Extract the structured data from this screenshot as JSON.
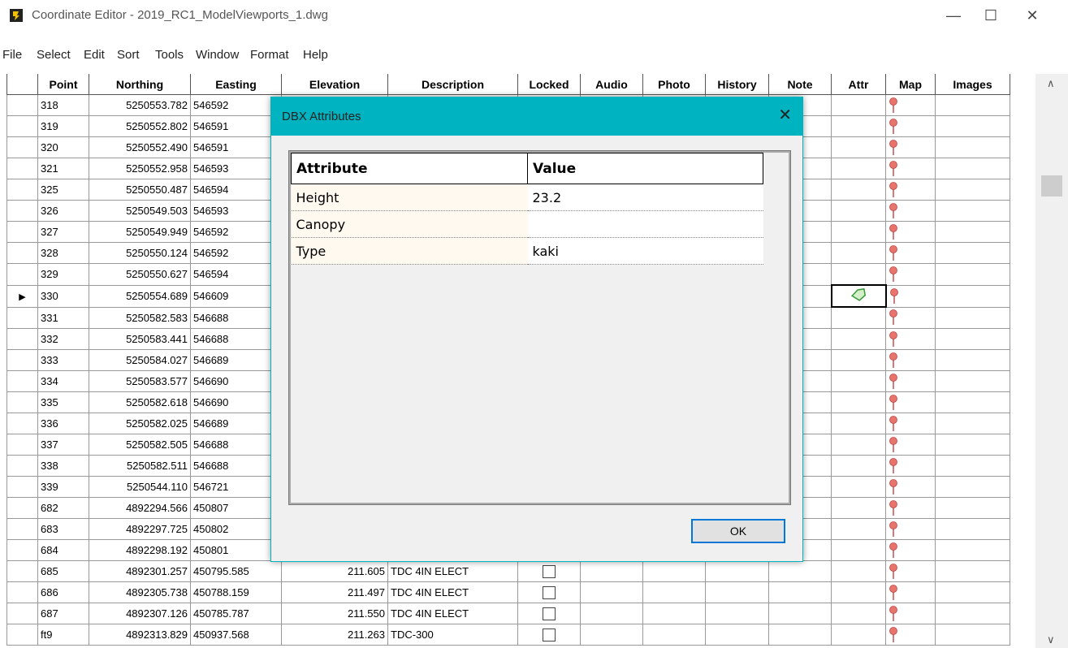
{
  "window": {
    "title": "Coordinate Editor - 2019_RC1_ModelViewports_1.dwg"
  },
  "menu": [
    "File",
    "Select",
    "Edit",
    "Sort",
    "Tools",
    "Window",
    "Format",
    "Help"
  ],
  "columns": [
    "Point",
    "Northing",
    "Easting",
    "Elevation",
    "Description",
    "Locked",
    "Audio",
    "Photo",
    "History",
    "Note",
    "Attr",
    "Map",
    "Images"
  ],
  "rows": [
    {
      "point": "318",
      "northing": "5250553.782",
      "easting": "546592",
      "elev": "",
      "desc": "",
      "locked": false
    },
    {
      "point": "319",
      "northing": "5250552.802",
      "easting": "546591",
      "elev": "",
      "desc": "",
      "locked": false
    },
    {
      "point": "320",
      "northing": "5250552.490",
      "easting": "546591",
      "elev": "",
      "desc": "",
      "locked": false
    },
    {
      "point": "321",
      "northing": "5250552.958",
      "easting": "546593",
      "elev": "",
      "desc": "",
      "locked": false
    },
    {
      "point": "325",
      "northing": "5250550.487",
      "easting": "546594",
      "elev": "",
      "desc": "",
      "locked": false
    },
    {
      "point": "326",
      "northing": "5250549.503",
      "easting": "546593",
      "elev": "",
      "desc": "",
      "locked": false
    },
    {
      "point": "327",
      "northing": "5250549.949",
      "easting": "546592",
      "elev": "",
      "desc": "",
      "locked": false
    },
    {
      "point": "328",
      "northing": "5250550.124",
      "easting": "546592",
      "elev": "",
      "desc": "",
      "locked": false
    },
    {
      "point": "329",
      "northing": "5250550.627",
      "easting": "546594",
      "elev": "",
      "desc": "",
      "locked": false
    },
    {
      "point": "330",
      "northing": "5250554.689",
      "easting": "546609",
      "elev": "",
      "desc": "",
      "locked": false,
      "selected": true,
      "attr": true
    },
    {
      "point": "331",
      "northing": "5250582.583",
      "easting": "546688",
      "elev": "",
      "desc": "",
      "locked": false
    },
    {
      "point": "332",
      "northing": "5250583.441",
      "easting": "546688",
      "elev": "",
      "desc": "",
      "locked": false
    },
    {
      "point": "333",
      "northing": "5250584.027",
      "easting": "546689",
      "elev": "",
      "desc": "",
      "locked": false
    },
    {
      "point": "334",
      "northing": "5250583.577",
      "easting": "546690",
      "elev": "",
      "desc": "",
      "locked": false
    },
    {
      "point": "335",
      "northing": "5250582.618",
      "easting": "546690",
      "elev": "",
      "desc": "",
      "locked": false
    },
    {
      "point": "336",
      "northing": "5250582.025",
      "easting": "546689",
      "elev": "",
      "desc": "",
      "locked": false
    },
    {
      "point": "337",
      "northing": "5250582.505",
      "easting": "546688",
      "elev": "",
      "desc": "",
      "locked": false
    },
    {
      "point": "338",
      "northing": "5250582.511",
      "easting": "546688",
      "elev": "",
      "desc": "",
      "locked": false
    },
    {
      "point": "339",
      "northing": "5250544.110",
      "easting": "546721",
      "elev": "",
      "desc": "",
      "locked": false
    },
    {
      "point": "682",
      "northing": "4892294.566",
      "easting": "450807",
      "elev": "",
      "desc": "",
      "locked": false
    },
    {
      "point": "683",
      "northing": "4892297.725",
      "easting": "450802",
      "elev": "",
      "desc": "",
      "locked": false
    },
    {
      "point": "684",
      "northing": "4892298.192",
      "easting": "450801",
      "elev": "",
      "desc": "",
      "locked": false
    },
    {
      "point": "685",
      "northing": "4892301.257",
      "easting": "450795.585",
      "elev": "211.605",
      "desc": "TDC 4IN ELECT",
      "locked": true
    },
    {
      "point": "686",
      "northing": "4892305.738",
      "easting": "450788.159",
      "elev": "211.497",
      "desc": "TDC 4IN ELECT",
      "locked": true
    },
    {
      "point": "687",
      "northing": "4892307.126",
      "easting": "450785.787",
      "elev": "211.550",
      "desc": "TDC 4IN ELECT",
      "locked": true
    },
    {
      "point": "ft9",
      "northing": "4892313.829",
      "easting": "450937.568",
      "elev": "211.263",
      "desc": "TDC-300",
      "locked": true
    }
  ],
  "dialog": {
    "title": "DBX Attributes",
    "headers": {
      "attribute": "Attribute",
      "value": "Value"
    },
    "rows": [
      {
        "key": "Height",
        "value": "23.2"
      },
      {
        "key": "Canopy",
        "value": ""
      },
      {
        "key": "Type",
        "value": "kaki"
      }
    ],
    "ok_label": "OK"
  },
  "icons": {
    "map": "map-pin-icon",
    "attr": "tag-icon",
    "app": "app-logo-icon"
  },
  "colors": {
    "dialog_border": "#00b3c1",
    "pin": "#e8756d",
    "ok_focus": "#0078d7"
  }
}
